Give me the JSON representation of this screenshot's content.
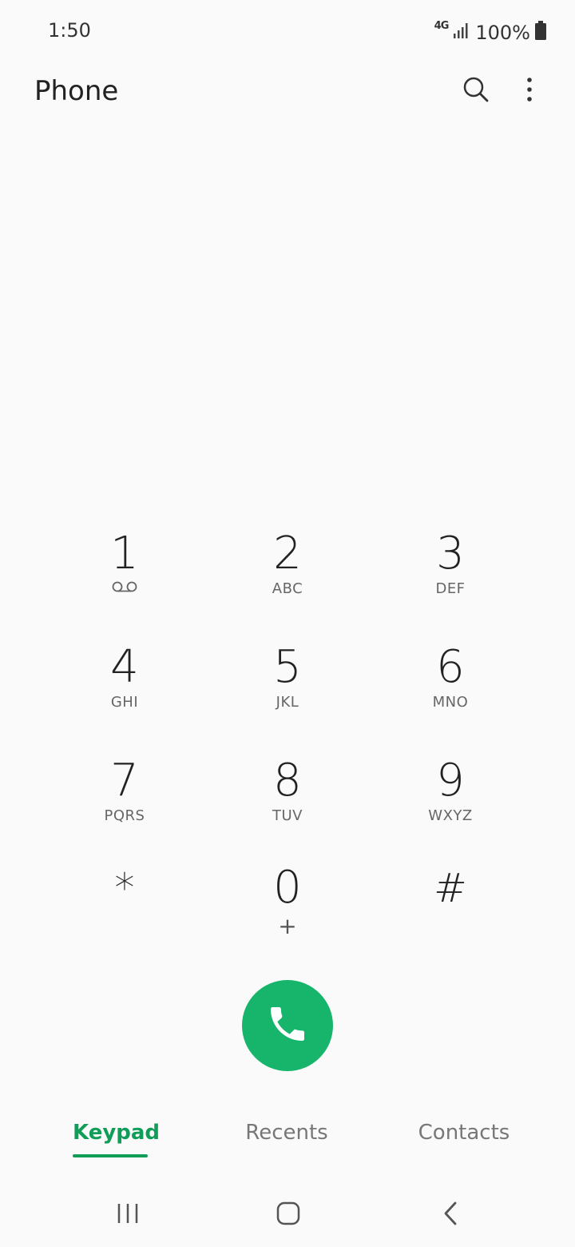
{
  "status_bar": {
    "time": "1:50",
    "network": "4G",
    "battery": "100%"
  },
  "app_bar": {
    "title": "Phone",
    "search_icon": "search-icon",
    "more_icon": "more-vert-icon"
  },
  "keypad": {
    "keys": [
      {
        "digit": "1",
        "sub": "",
        "icon": "voicemail-icon"
      },
      {
        "digit": "2",
        "sub": "ABC"
      },
      {
        "digit": "3",
        "sub": "DEF"
      },
      {
        "digit": "4",
        "sub": "GHI"
      },
      {
        "digit": "5",
        "sub": "JKL"
      },
      {
        "digit": "6",
        "sub": "MNO"
      },
      {
        "digit": "7",
        "sub": "PQRS"
      },
      {
        "digit": "8",
        "sub": "TUV"
      },
      {
        "digit": "9",
        "sub": "WXYZ"
      },
      {
        "digit": "*",
        "sub": ""
      },
      {
        "digit": "0",
        "sub": "+"
      },
      {
        "digit": "#",
        "sub": ""
      }
    ]
  },
  "call_button": {
    "icon": "phone-icon",
    "color": "#16b56b"
  },
  "tabs": [
    {
      "label": "Keypad",
      "active": true
    },
    {
      "label": "Recents",
      "active": false
    },
    {
      "label": "Contacts",
      "active": false
    }
  ],
  "colors": {
    "accent": "#0f9d58",
    "background": "#fafafa"
  },
  "nav_bar": {
    "recents_icon": "recent-apps-icon",
    "home_icon": "home-icon",
    "back_icon": "back-icon"
  }
}
